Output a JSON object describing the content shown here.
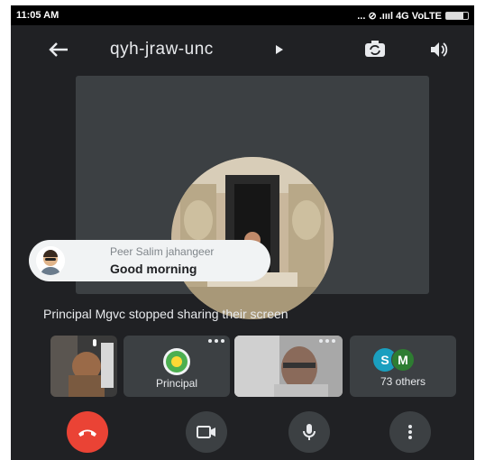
{
  "status_bar": {
    "time": "11:05 AM",
    "network": "... ⊘ .ıııl 4G VoLTE"
  },
  "header": {
    "meeting_code": "qyh-jraw-unc",
    "back_icon": "arrow-left-icon",
    "switch_camera_icon": "switch-camera-icon",
    "speaker_icon": "speaker-icon"
  },
  "chat_toast": {
    "sender": "Peer Salim jahangeer",
    "message": "Good morning"
  },
  "status_message": "Principal Mgvc stopped sharing their screen",
  "participants": {
    "principal_label": "Principal",
    "others_label": "73 others",
    "others_initials": [
      "S",
      "M"
    ],
    "others_colors": [
      "#1a9fbf",
      "#2e7d32"
    ]
  },
  "controls": {
    "hangup_icon": "phone-hangup-icon",
    "video_icon": "video-camera-icon",
    "mic_icon": "microphone-icon",
    "more_icon": "more-vertical-icon"
  },
  "colors": {
    "background": "#202124",
    "hangup": "#ea4335",
    "tile": "#3c4043"
  }
}
